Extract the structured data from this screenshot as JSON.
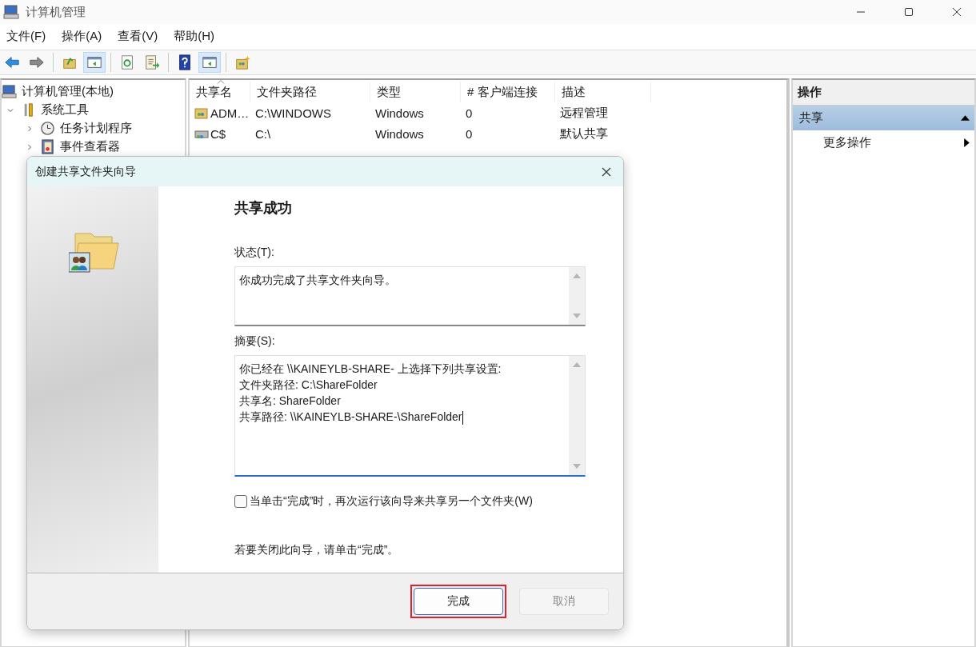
{
  "window": {
    "title": "计算机管理"
  },
  "menu": [
    "文件(F)",
    "操作(A)",
    "查看(V)",
    "帮助(H)"
  ],
  "toolbar": [
    {
      "kind": "back",
      "on": false
    },
    {
      "kind": "forward",
      "on": false
    },
    {
      "kind": "up",
      "on": false
    },
    {
      "kind": "tree-pane",
      "on": true
    },
    {
      "kind": "refresh",
      "on": false
    },
    {
      "kind": "export",
      "on": false
    },
    {
      "kind": "help",
      "on": false
    },
    {
      "kind": "action-pane",
      "on": true
    },
    {
      "kind": "new-share",
      "on": false
    }
  ],
  "tree": [
    {
      "label": "计算机管理(本地)",
      "kind": "computer",
      "children": [
        {
          "label": "系统工具",
          "kind": "tools",
          "expanded": true,
          "children": [
            {
              "label": "任务计划程序",
              "kind": "clock",
              "expanded": false
            },
            {
              "label": "事件查看器",
              "kind": "event",
              "expanded": false
            }
          ]
        }
      ]
    }
  ],
  "list": {
    "columns": [
      {
        "label": "共享名",
        "sorted": true
      },
      {
        "label": "文件夹路径",
        "sorted": false
      },
      {
        "label": "类型",
        "sorted": false
      },
      {
        "label": "# 客户端连接",
        "sorted": false
      },
      {
        "label": "描述",
        "sorted": false
      }
    ],
    "rows": [
      {
        "kind": "share",
        "name": "ADM…",
        "path": "C:\\WINDOWS",
        "type": "Windows",
        "connections": "0",
        "description": "远程管理"
      },
      {
        "kind": "drive",
        "name": "C$",
        "path": "C:\\",
        "type": "Windows",
        "connections": "0",
        "description": "默认共享"
      }
    ]
  },
  "actions": {
    "title": "操作",
    "section": {
      "label": "共享",
      "expanded": true
    },
    "items": [
      {
        "label": "更多操作"
      }
    ]
  },
  "dialog": {
    "title": "创建共享文件夹向导",
    "heading": "共享成功",
    "status": {
      "label": "状态(T):",
      "text": "你成功完成了共享文件夹向导。"
    },
    "summary": {
      "label": "摘要(S):",
      "lines": [
        "你已经在 \\\\KAINEYLB-SHARE- 上选择下列共享设置:",
        "文件夹路径: C:\\ShareFolder",
        "共享名: ShareFolder",
        "共享路径: \\\\KAINEYLB-SHARE-\\ShareFolder"
      ]
    },
    "checkbox": {
      "label": "当单击“完成”时，再次运行该向导来共享另一个文件夹(W)",
      "checked": false
    },
    "note": "若要关闭此向导，请单击“完成”。",
    "buttons": [
      {
        "label": "完成",
        "disabled": false,
        "highlighted": true
      },
      {
        "label": "取消",
        "disabled": true,
        "highlighted": false
      }
    ]
  }
}
